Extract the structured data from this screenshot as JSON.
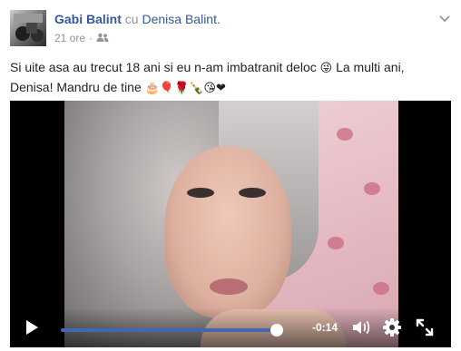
{
  "post": {
    "author": "Gabi Balint",
    "with_word": "cu",
    "tagged": "Denisa Balint.",
    "time": "21 ore",
    "separator": "·",
    "text_line1": "Si uite asa au trecut 18 ani si eu n-am imbatranit deloc",
    "text_emoji1": "😜",
    "text_line1b": " La multi ani,",
    "text_line2": "Denisa! Mandru de tine",
    "text_emojis2": "🎂🎈🌹🍾😘❤"
  },
  "video": {
    "time_remaining": "-0:14",
    "progress": 0.86,
    "icons": [
      "play-icon",
      "volume-icon",
      "settings-gear-icon",
      "fullscreen-icon"
    ]
  }
}
